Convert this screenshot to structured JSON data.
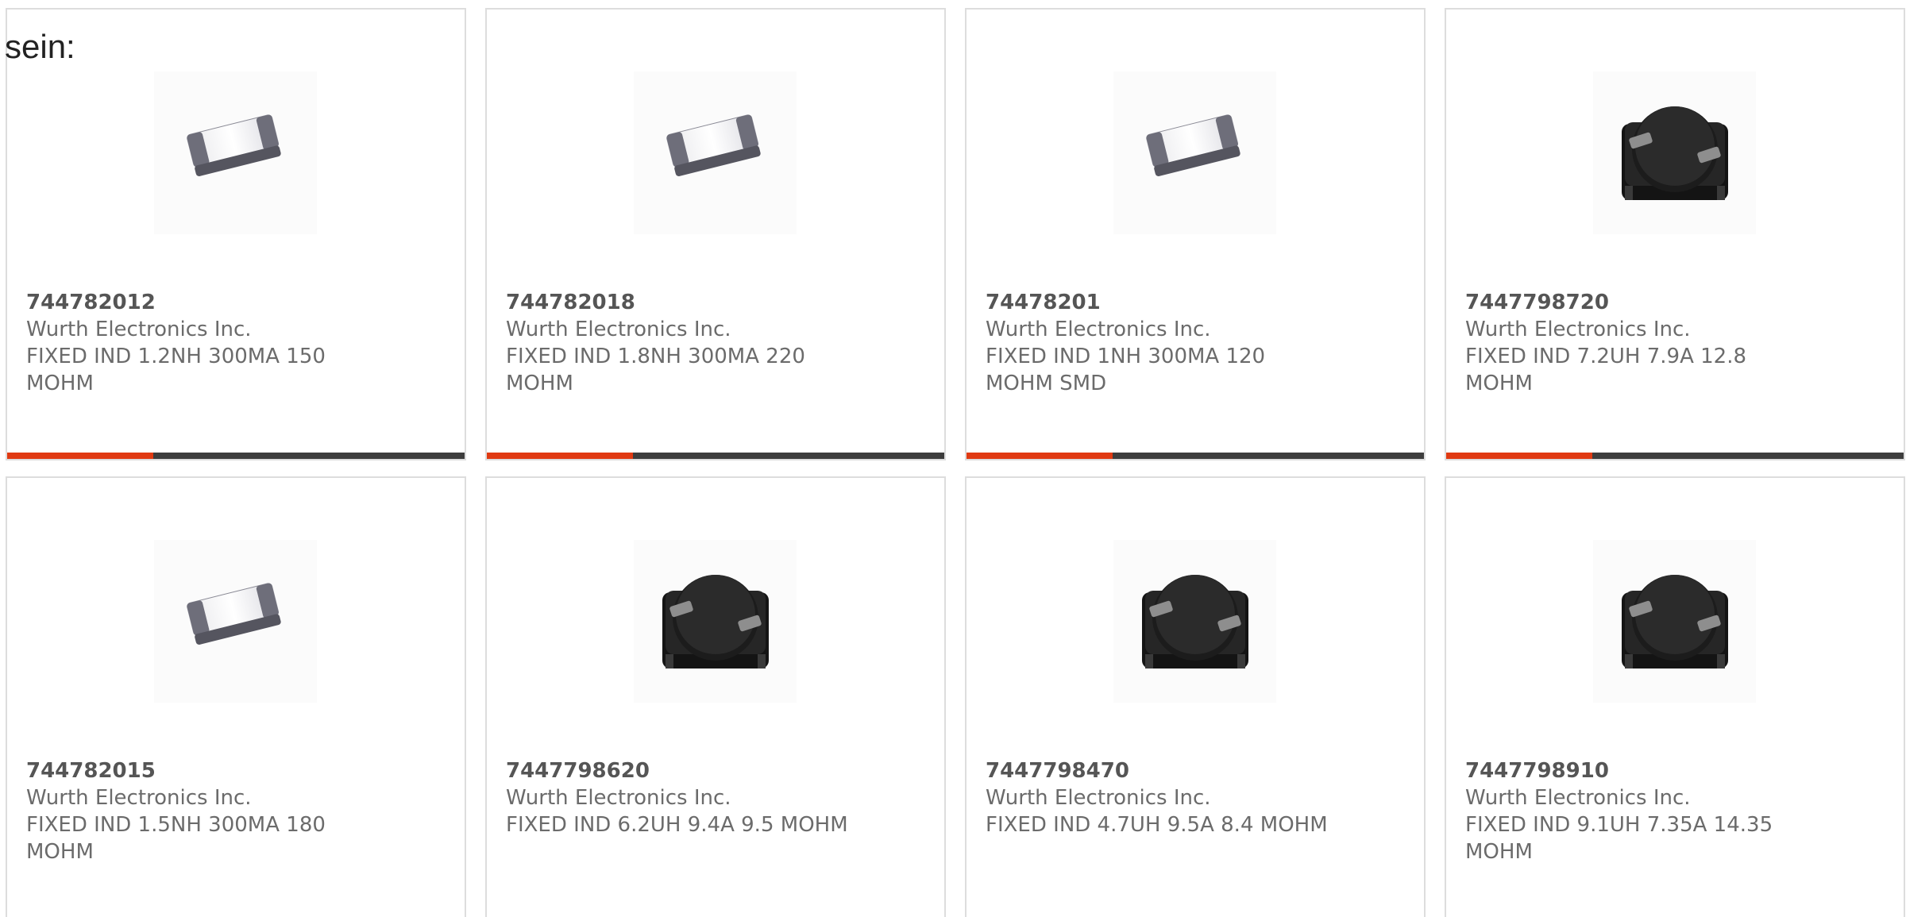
{
  "intro": {
    "text": "sein:"
  },
  "theme": {
    "accent": "#e03a12",
    "bar_dark": "#3d3d3d"
  },
  "products": [
    {
      "part_number": "744782012",
      "manufacturer": "Wurth Electronics Inc.",
      "description": "FIXED IND 1.2NH 300MA 150 MOHM",
      "image": "chip-inductor-icon",
      "rating_fraction": 0.32
    },
    {
      "part_number": "744782018",
      "manufacturer": "Wurth Electronics Inc.",
      "description": "FIXED IND 1.8NH 300MA 220 MOHM",
      "image": "chip-inductor-icon",
      "rating_fraction": 0.32
    },
    {
      "part_number": "74478201",
      "manufacturer": "Wurth Electronics Inc.",
      "description": "FIXED IND 1NH 300MA 120 MOHM SMD",
      "image": "chip-inductor-icon",
      "rating_fraction": 0.32
    },
    {
      "part_number": "7447798720",
      "manufacturer": "Wurth Electronics Inc.",
      "description": "FIXED IND 7.2UH 7.9A 12.8 MOHM",
      "image": "power-inductor-icon",
      "rating_fraction": 0.32
    },
    {
      "part_number": "744782015",
      "manufacturer": "Wurth Electronics Inc.",
      "description": "FIXED IND 1.5NH 300MA 180 MOHM",
      "image": "chip-inductor-icon"
    },
    {
      "part_number": "7447798620",
      "manufacturer": "Wurth Electronics Inc.",
      "description": "FIXED IND 6.2UH 9.4A 9.5 MOHM",
      "image": "power-inductor-icon"
    },
    {
      "part_number": "7447798470",
      "manufacturer": "Wurth Electronics Inc.",
      "description": "FIXED IND 4.7UH 9.5A 8.4 MOHM",
      "image": "power-inductor-icon"
    },
    {
      "part_number": "7447798910",
      "manufacturer": "Wurth Electronics Inc.",
      "description": "FIXED IND 9.1UH 7.35A 14.35 MOHM",
      "image": "power-inductor-icon"
    }
  ]
}
